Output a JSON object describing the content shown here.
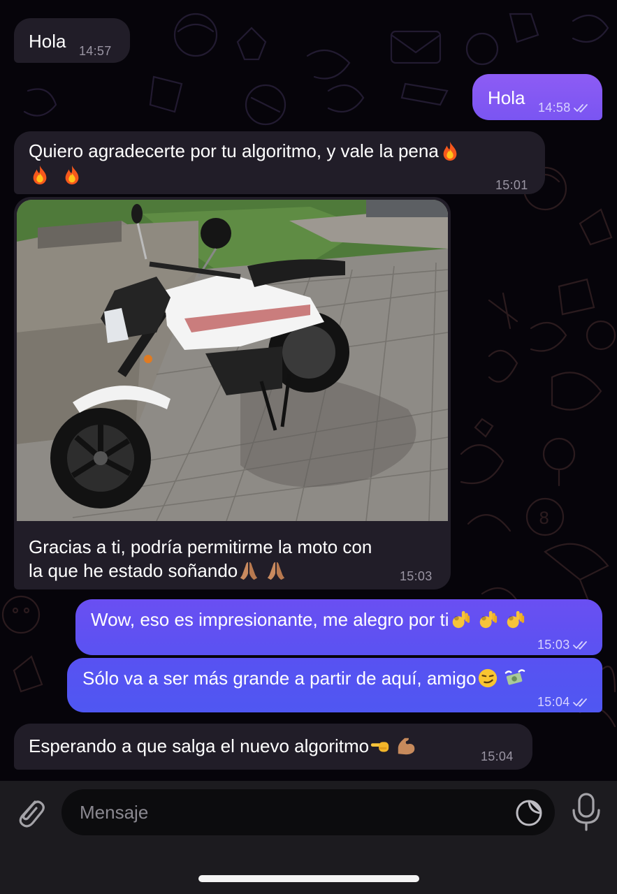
{
  "messages": [
    {
      "id": "m1",
      "direction": "incoming",
      "text": "Hola",
      "time": "14:57"
    },
    {
      "id": "m2",
      "direction": "outgoing",
      "text": "Hola",
      "time": "14:58",
      "read": true
    },
    {
      "id": "m3",
      "direction": "incoming",
      "text_line1": "Quiero agradecerte por tu algoritmo, y vale la pena",
      "emoji_line1": [
        "fire"
      ],
      "emoji_line2": [
        "fire",
        "fire"
      ],
      "time": "15:01"
    },
    {
      "id": "m4",
      "direction": "incoming",
      "photo": "white-motorcycle",
      "text_line1": "Gracias a ti, podría permitirme la moto con",
      "text_line2": "la que he estado soñando",
      "emojis": [
        "folded-hands",
        "folded-hands"
      ],
      "time": "15:03"
    },
    {
      "id": "m5",
      "direction": "outgoing",
      "text": "Wow, eso es impresionante, me alegro por ti",
      "emojis": [
        "ok-hand",
        "ok-hand",
        "ok-hand"
      ],
      "time": "15:03",
      "read": true
    },
    {
      "id": "m6",
      "direction": "outgoing",
      "text": "Sólo va a ser más grande a partir de aquí, amigo",
      "emojis": [
        "smirking-face",
        "money-with-wings"
      ],
      "time": "15:04",
      "read": true
    },
    {
      "id": "m7",
      "direction": "incoming",
      "text": "Esperando a que salga el nuevo algoritmo",
      "emojis": [
        "backhand-index-pointing-left",
        "flexed-biceps"
      ],
      "time": "15:04"
    }
  ],
  "composer": {
    "placeholder": "Mensaje",
    "attach_icon": "paperclip-icon",
    "sticker_icon": "sticker-icon",
    "mic_icon": "microphone-icon"
  },
  "colors": {
    "background": "#06040a",
    "incoming_bubble": "#211d28",
    "outgoing_bubble_top": "#8a5cf4",
    "outgoing_bubble_bottom": "#4f57f2",
    "time_incoming": "#9a95a3",
    "time_outgoing": "#d8d4ff"
  }
}
